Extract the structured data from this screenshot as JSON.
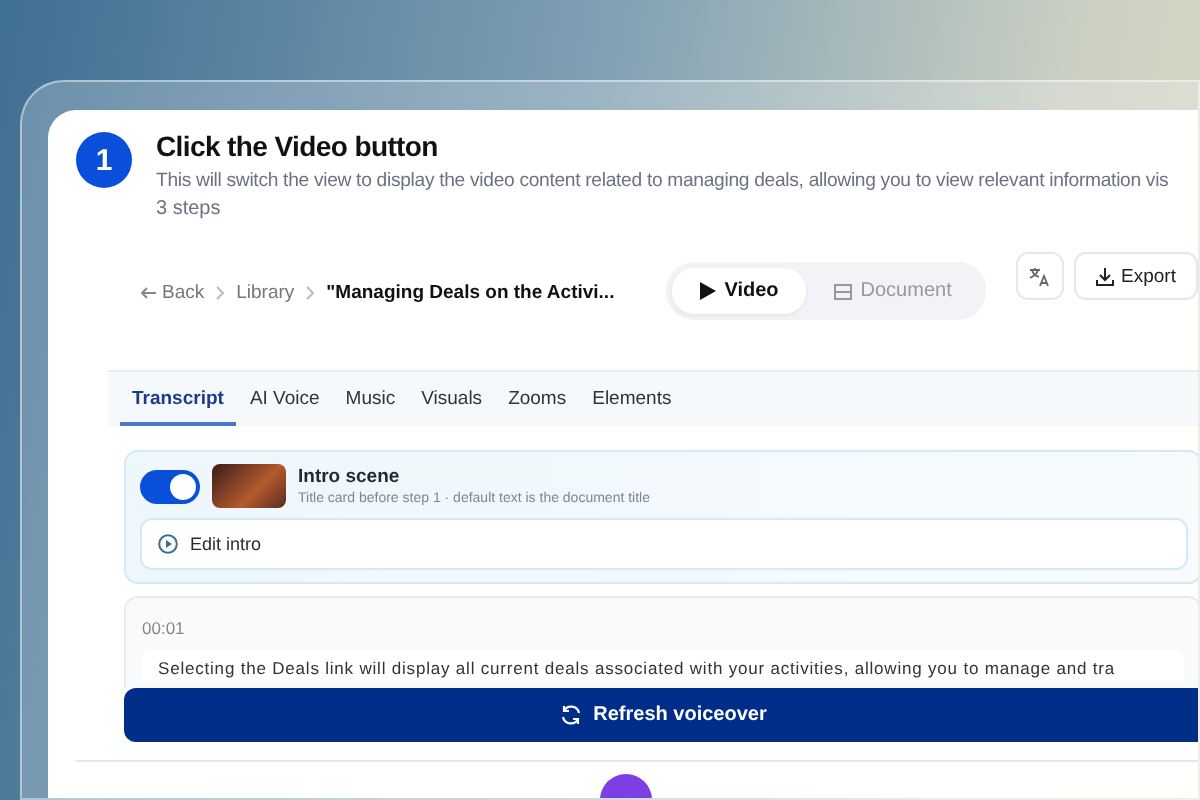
{
  "step": {
    "number": "1",
    "title": "Click the Video button",
    "description": "This will switch the view to display the video content related to managing deals, allowing you to view relevant information vis",
    "count": "3 steps"
  },
  "toolbar": {
    "back": "Back",
    "breadcrumbs": [
      "Library"
    ],
    "document_title": "\"Managing Deals on the Activi...",
    "view_toggle": [
      {
        "label": "Video",
        "selected": true
      },
      {
        "label": "Document",
        "selected": false
      }
    ],
    "export": "Export"
  },
  "tabs": [
    {
      "label": "Transcript",
      "selected": true
    },
    {
      "label": "AI Voice",
      "selected": false
    },
    {
      "label": "Music",
      "selected": false
    },
    {
      "label": "Visuals",
      "selected": false
    },
    {
      "label": "Zooms",
      "selected": false
    },
    {
      "label": "Elements",
      "selected": false
    }
  ],
  "intro": {
    "enabled": true,
    "title": "Intro scene",
    "subtitle": "Title card before step 1 · default text is the document title",
    "edit": "Edit intro"
  },
  "transcript": {
    "time": "00:01",
    "text": "Selecting the Deals link will display all current deals associated with your activities, allowing you to manage and tra"
  },
  "refresh_button": "Refresh voiceover"
}
